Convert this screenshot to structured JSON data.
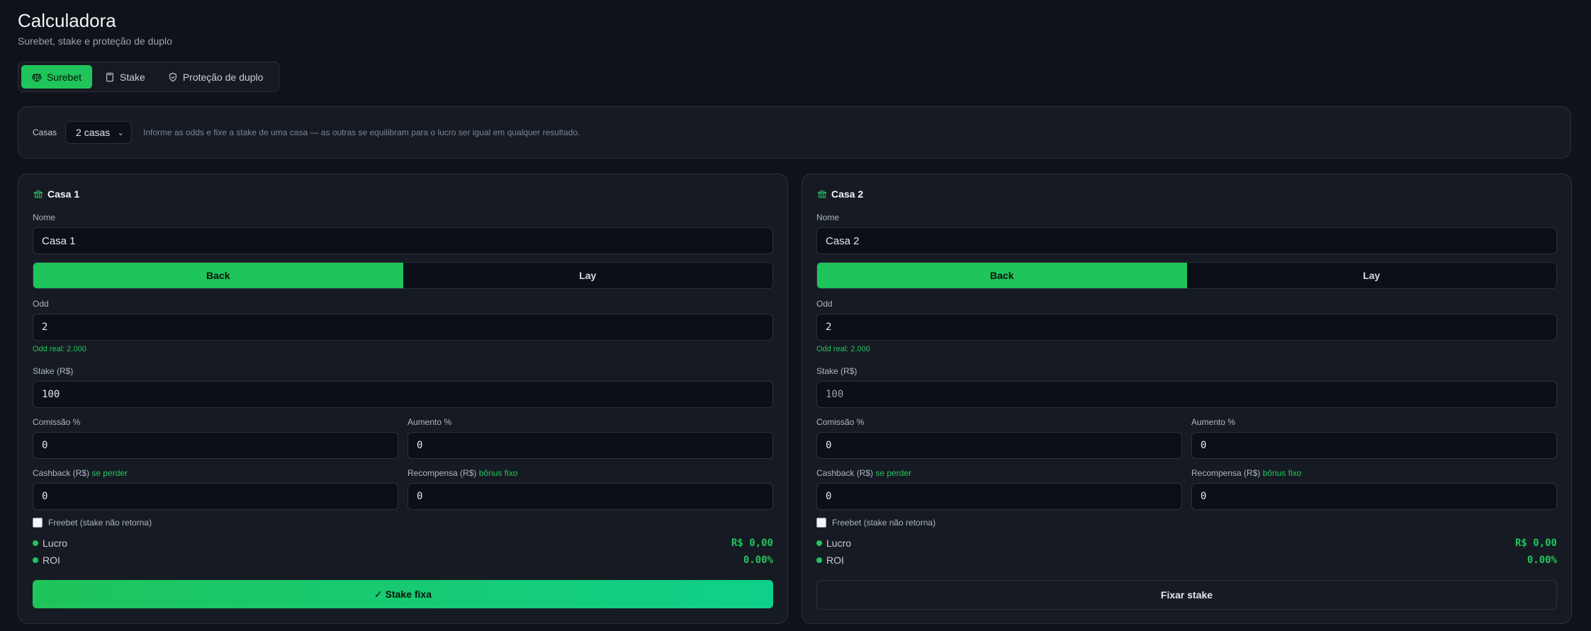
{
  "header": {
    "title": "Calculadora",
    "subtitle": "Surebet, stake e proteção de duplo"
  },
  "tabs": [
    {
      "label": "Surebet",
      "icon": "scale-icon",
      "active": true
    },
    {
      "label": "Stake",
      "icon": "calculator-icon",
      "active": false
    },
    {
      "label": "Proteção de duplo",
      "icon": "shield-check-icon",
      "active": false
    }
  ],
  "casas": {
    "label": "Casas",
    "selected": "2 casas",
    "hint": "Informe as odds e fixe a stake de uma casa — as outras se equilibram para o lucro ser igual em qualquer resultado."
  },
  "houses": [
    {
      "title": "Casa 1",
      "name_label": "Nome",
      "name_value": "Casa 1",
      "back_label": "Back",
      "lay_label": "Lay",
      "odd_label": "Odd",
      "odd_value": "2",
      "odd_real": "Odd real: 2.000",
      "stake_label": "Stake (R$)",
      "stake_value": "100",
      "comissao_label": "Comissão %",
      "comissao_value": "0",
      "aumento_label": "Aumento %",
      "aumento_value": "0",
      "cashback_label": "Cashback (R$)",
      "cashback_tag": "se perder",
      "cashback_value": "0",
      "recompensa_label": "Recompensa (R$)",
      "recompensa_tag": "bônus fixo",
      "recompensa_value": "0",
      "freebet_label": "Freebet (stake não retorna)",
      "lucro_label": "Lucro",
      "lucro_value": "R$ 0,00",
      "roi_label": "ROI",
      "roi_value": "0.00%",
      "button_label": "✓ Stake fixa"
    },
    {
      "title": "Casa 2",
      "name_label": "Nome",
      "name_value": "Casa 2",
      "back_label": "Back",
      "lay_label": "Lay",
      "odd_label": "Odd",
      "odd_value": "2",
      "odd_real": "Odd real: 2.000",
      "stake_label": "Stake (R$)",
      "stake_value": "100",
      "comissao_label": "Comissão %",
      "comissao_value": "0",
      "aumento_label": "Aumento %",
      "aumento_value": "0",
      "cashback_label": "Cashback (R$)",
      "cashback_tag": "se perder",
      "cashback_value": "0",
      "recompensa_label": "Recompensa (R$)",
      "recompensa_tag": "bônus fixo",
      "recompensa_value": "0",
      "freebet_label": "Freebet (stake não retorna)",
      "lucro_label": "Lucro",
      "lucro_value": "R$ 0,00",
      "roi_label": "ROI",
      "roi_value": "0.00%",
      "button_label": "Fixar stake"
    }
  ],
  "colors": {
    "accent": "#1fc45a",
    "background": "#0f1218",
    "card": "#161b23",
    "border": "#2a303b"
  }
}
